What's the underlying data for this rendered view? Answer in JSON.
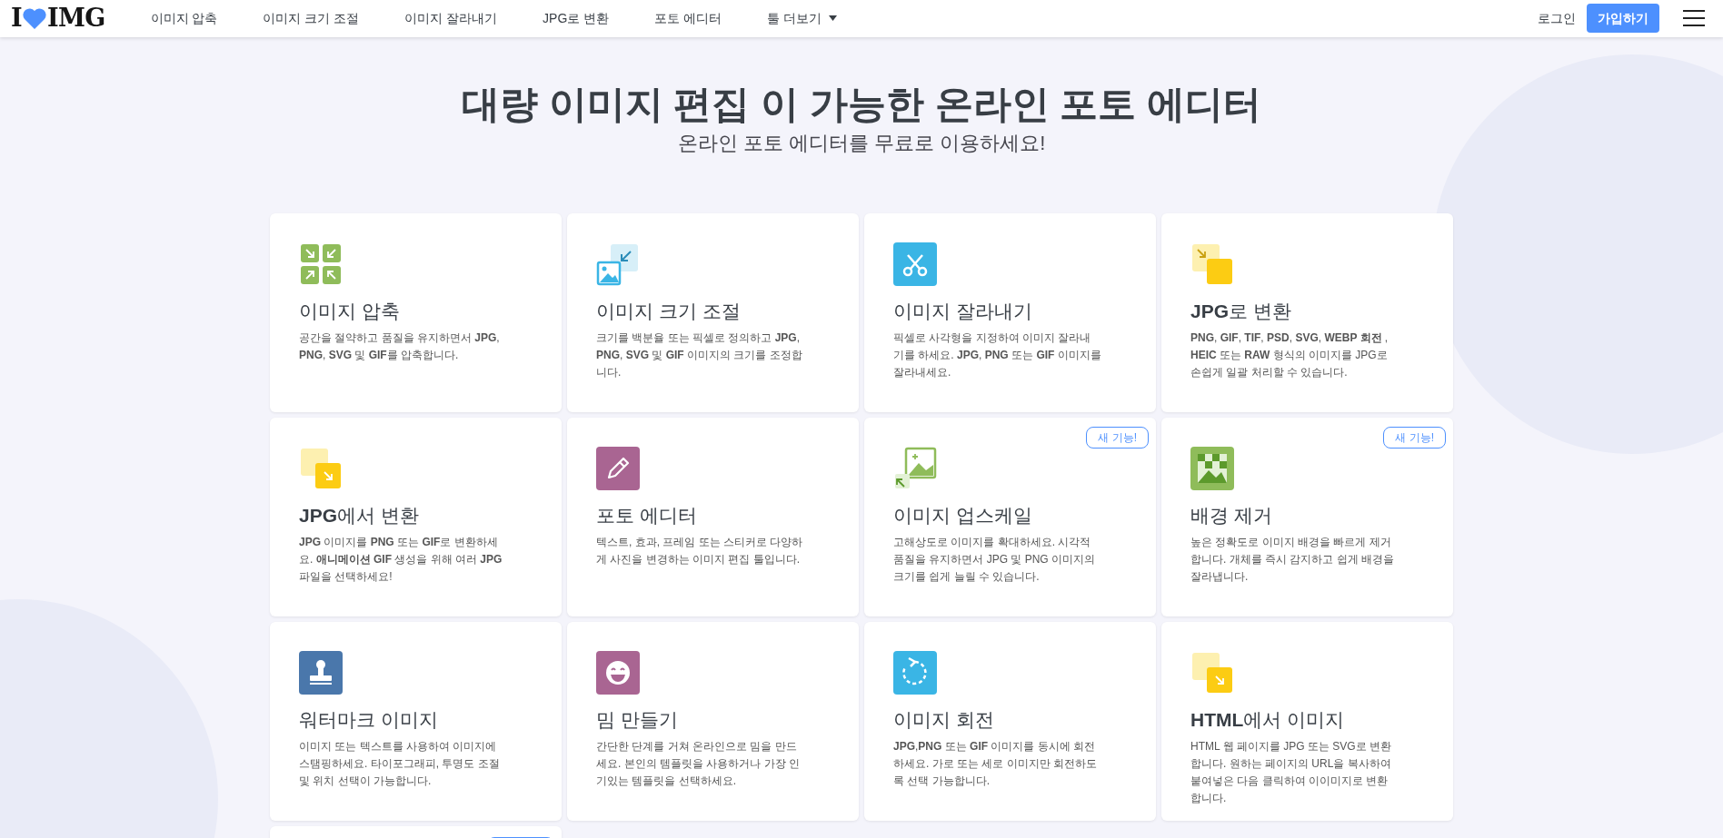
{
  "header": {
    "logo": {
      "left": "I",
      "right": "IMG"
    },
    "nav": [
      {
        "label": "이미지 압축",
        "dropdown": false
      },
      {
        "label": "이미지 크기 조절",
        "dropdown": false
      },
      {
        "label": "이미지 잘라내기",
        "dropdown": false
      },
      {
        "label": "JPG로 변환",
        "dropdown": false
      },
      {
        "label": "포토 에디터",
        "dropdown": false
      },
      {
        "label": "툴 더보기",
        "dropdown": true
      }
    ],
    "login": "로그인",
    "signup": "가입하기"
  },
  "hero": {
    "title": "대량 이미지 편집 이 가능한 온라인 포토 에디터",
    "subtitle": "온라인 포토 에디터를 무료로 이용하세요!"
  },
  "cards": [
    {
      "kind": "compress",
      "title": "이미지 압축",
      "description": "공간을 절약하고 품질을 유지하면서 **JPG**, **PNG**, **SVG** 및 **GIF**를 압축합니다."
    },
    {
      "kind": "resize",
      "title": "이미지 크기 조절",
      "description": "크기를 백분율 또는 픽셀로 정의하고 **JPG**, **PNG**, **SVG** 및 **GIF** 이미지의 크기를 조정합니다."
    },
    {
      "kind": "crop",
      "title": "이미지 잘라내기",
      "description": "픽셀로 사각형을 지정하여 이미지 잘라내기를 하세요. **JPG**, **PNG** 또는 **GIF** 이미지를 잘라내세요."
    },
    {
      "kind": "to-jpg",
      "title": "**JPG**로 변환",
      "description": "**PNG**, **GIF**, **TIF**, **PSD**, **SVG**, **WEBP 회전** , **HEIC** 또는 **RAW** 형식의 이미지를 JPG로 손쉽게 일괄 처리할 수 있습니다."
    },
    {
      "kind": "from-jpg",
      "title": "**JPG**에서 변환",
      "description": "**JPG** 이미지를 **PNG** 또는 **GIF**로 변환하세요. **애니메이션 GIF** 생성을 위해 여러 **JPG** 파일을 선택하세요!"
    },
    {
      "kind": "editor",
      "title": "포토 에디터",
      "description": "텍스트, 효과, 프레임 또는 스티커로 다양하게 사진을 변경하는 이미지 편집 툴입니다."
    },
    {
      "kind": "upscale",
      "title": "이미지 업스케일",
      "description": "고해상도로 이미지를 확대하세요. 시각적 품질을 유지하면서 JPG 및 PNG 이미지의 크기를 쉽게 늘릴 수 있습니다.",
      "badge": "새 기능!"
    },
    {
      "kind": "remove-bg",
      "title": "배경 제거",
      "description": "높은 정확도로 이미지 배경을 빠르게 제거합니다. 개체를 즉시 감지하고 쉽게 배경을 잘라냅니다.",
      "badge": "새 기능!"
    },
    {
      "kind": "watermark",
      "title": "워터마크 이미지",
      "description": "이미지 또는 텍스트를 사용하여 이미지에 스탬핑하세요. 타이포그래피, 투명도 조절 및 위치 선택이 가능합니다."
    },
    {
      "kind": "meme",
      "title": "밈 만들기",
      "description": "간단한 단계를 거쳐 온라인으로 밈을 만드세요. 본인의 템플릿을 사용하거나 가장 인기있는 템플릿을 선택하세요."
    },
    {
      "kind": "rotate",
      "title": "이미지 회전",
      "description": "**JPG**,**PNG** 또는 **GIF** 이미지를 동시에 회전하세요. 가로 또는 세로 이미지만 회전하도록 선택 가능합니다."
    },
    {
      "kind": "html",
      "title": "**HTML**에서 이미지",
      "description": "HTML 웹 페이지를 JPG 또는 SVG로 변환합니다. 원하는 페이지의 URL을 복사하여 붙여넣은 다음 클릭하여 이이미지로 변환합니다."
    },
    {
      "kind": "cut-off",
      "badge_outline": true
    }
  ]
}
